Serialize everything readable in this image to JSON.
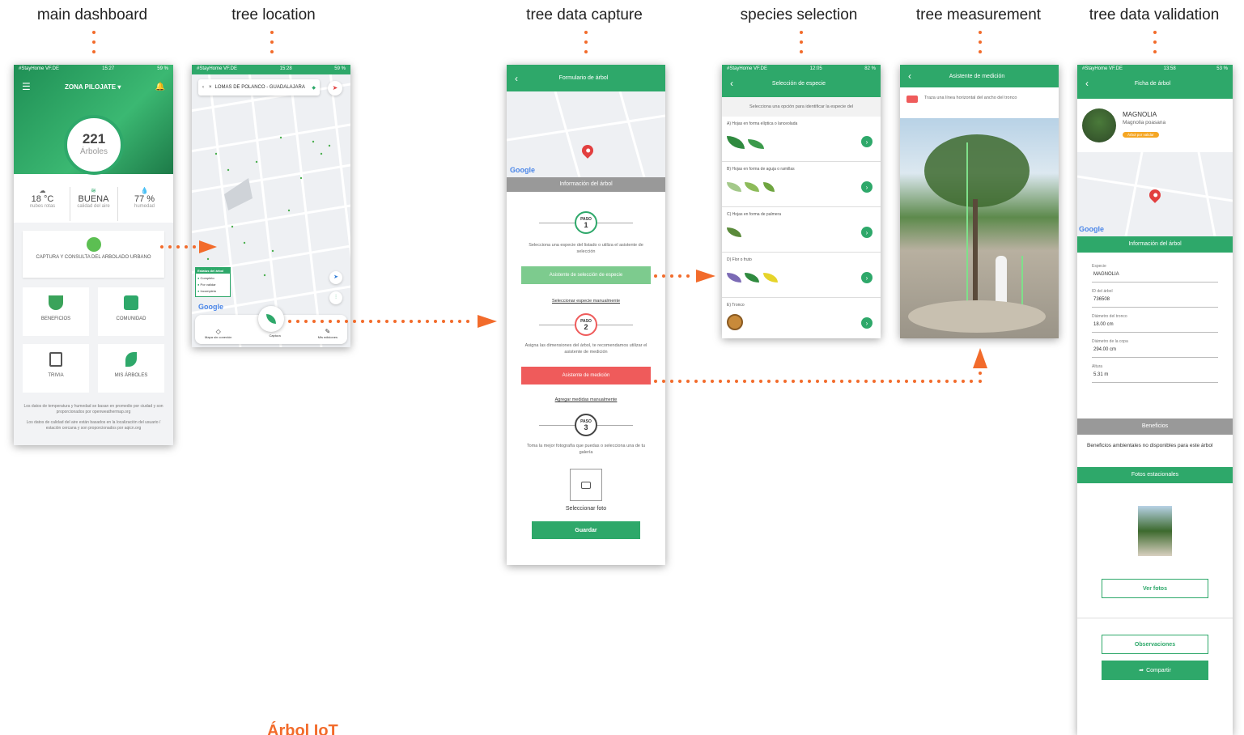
{
  "labels": [
    "main dashboard",
    "tree location",
    "tree data capture",
    "species selection",
    "tree measurement",
    "tree data validation"
  ],
  "footer_title": "Árbol IoT",
  "colors": {
    "brand_green": "#2ea86a",
    "arrow_orange": "#f26b2b",
    "alert_red": "#ef5b5b",
    "badge_orange": "#f5a623"
  },
  "dashboard": {
    "status": {
      "carrier": "#StayHome VF.DE",
      "time": "15:27",
      "battery": "59 %"
    },
    "zone": "ZONA PILOJATE",
    "count": "221",
    "count_label": "Árboles",
    "weather": [
      {
        "icon": "cloud-icon",
        "value": "18 °C",
        "caption": "nubes rotas"
      },
      {
        "icon": "wind-icon",
        "value": "BUENA",
        "caption": "calidad del aire"
      },
      {
        "icon": "drop-icon",
        "value": "77 %",
        "caption": "humedad"
      }
    ],
    "main_card": "CAPTURA Y CONSULTA DEL ARBOLADO URBANO",
    "cards": [
      "BENEFICIOS",
      "COMUNIDAD",
      "TRIVIA",
      "MIS ÁRBOLES"
    ],
    "note1": "Los datos de temperatura y humedad se basan en promedio por ciudad y son proporcionados por openweathermap.org",
    "note2": "Los datos de calidad del aire están basados en la localización del usuario / estación cercana y son proporcionados por aqicn.org"
  },
  "location": {
    "status": {
      "carrier": "#StayHome VF.DE",
      "time": "15:28",
      "battery": "59 %"
    },
    "search": "LOMAS DE POLANCO - GUADALAJARA",
    "legend_title": "Estatus del árbol",
    "legend": [
      "Completo",
      "Por validar",
      "Incompleto"
    ],
    "google": "Google",
    "nav": [
      "Mapa sin conexión",
      "Captura",
      "Mis ediciones"
    ]
  },
  "capture": {
    "title": "Formulario de árbol",
    "google": "Google",
    "section": "Información del árbol",
    "step_word": "PASO",
    "steps": [
      "1",
      "2",
      "3"
    ],
    "text1": "Selecciona una especie del listado o utiliza el asistente de selección",
    "btn1": "Asistente de selección de especie",
    "link1": "Seleccionar especie manualmente",
    "text2": "Asigna las dimensiones del árbol, te recomendamos utilizar el asistente de medición",
    "btn2": "Asistente de medición",
    "link2": "Agregar medidas manualmente",
    "text3": "Toma la mejor fotografía que puedas o selecciona una de tu galería",
    "photo_label": "Seleccionar foto",
    "save": "Guardar"
  },
  "species": {
    "status": {
      "carrier": "#StayHome VF.DE",
      "time": "12:05",
      "battery": "82 %"
    },
    "title": "Selección de especie",
    "prompt": "Selecciona una opción para identificar la especie del",
    "options": [
      "A) Hojas en forma elíptica o lanceolada",
      "B) Hojas en forma de aguja o ramillas",
      "C) Hojas en forma de palmera",
      "D) Flor o fruto",
      "E) Tronco"
    ]
  },
  "measure": {
    "title": "Asistente de medición",
    "hint": "Traza una línea horizontal del ancho del tronco"
  },
  "validation": {
    "status": {
      "carrier": "#StayHome VF.DE",
      "time": "13:58",
      "battery": "53 %"
    },
    "title": "Ficha de árbol",
    "name": "MAGNOLIA",
    "scientific": "Magnolia poasana",
    "badge": "Árbol por validar",
    "google": "Google",
    "section": "Información del árbol",
    "fields": [
      {
        "label": "Especie",
        "value": "MAGNOLIA"
      },
      {
        "label": "ID del árbol",
        "value": "736508"
      },
      {
        "label": "Diámetro del tronco",
        "value": "18.00 cm"
      },
      {
        "label": "Diámetro de la copa",
        "value": "294.00 cm"
      },
      {
        "label": "Altura",
        "value": "5.31 m"
      }
    ],
    "benefits_header": "Beneficios",
    "benefits_text": "Beneficios ambientales no disponibles para este árbol",
    "photos_header": "Fotos estacionales",
    "btn_photos": "Ver fotos",
    "btn_obs": "Observaciones",
    "btn_share": "Compartir"
  }
}
